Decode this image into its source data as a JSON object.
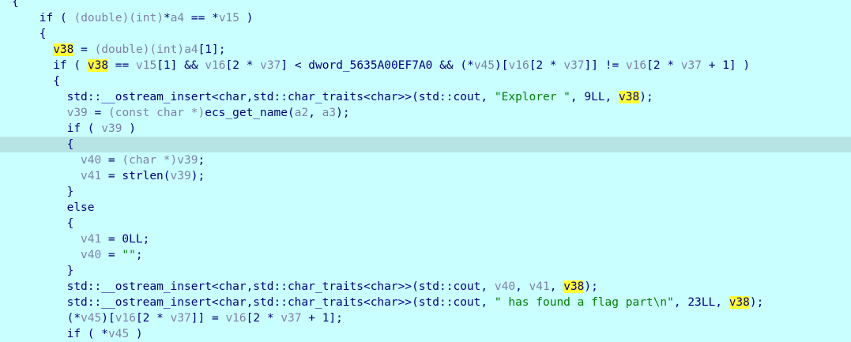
{
  "editor": {
    "current_line": 9,
    "colors": {
      "background": "#c9ffff",
      "current_line": "#b6e4e4",
      "highlight": "#ffff33",
      "code": "#000080",
      "variable": "#8080a8",
      "string": "#008000"
    },
    "lines": [
      {
        "indent": 0,
        "tokens": [
          [
            "id",
            "{"
          ]
        ]
      },
      {
        "indent": 2,
        "tokens": [
          [
            "kw",
            "if"
          ],
          [
            "op",
            " ( "
          ],
          [
            "var",
            "(double)(int)"
          ],
          [
            "op",
            "*"
          ],
          [
            "var",
            "a4"
          ],
          [
            "op",
            " == *"
          ],
          [
            "var",
            "v15"
          ],
          [
            "op",
            " )"
          ]
        ]
      },
      {
        "indent": 2,
        "tokens": [
          [
            "op",
            "{"
          ]
        ]
      },
      {
        "indent": 3,
        "tokens": [
          [
            "hl",
            "v38"
          ],
          [
            "op",
            " = "
          ],
          [
            "var",
            "(double)(int)"
          ],
          [
            "var",
            "a4"
          ],
          [
            "op",
            "[1];"
          ]
        ]
      },
      {
        "indent": 3,
        "tokens": [
          [
            "kw",
            "if"
          ],
          [
            "op",
            " ( "
          ],
          [
            "hl",
            "v38"
          ],
          [
            "op",
            " == "
          ],
          [
            "var",
            "v15"
          ],
          [
            "op",
            "[1] && "
          ],
          [
            "var",
            "v16"
          ],
          [
            "op",
            "[2 * "
          ],
          [
            "var",
            "v37"
          ],
          [
            "op",
            "] < "
          ],
          [
            "id",
            "dword_5635A00EF7A0"
          ],
          [
            "op",
            " && (*"
          ],
          [
            "var",
            "v45"
          ],
          [
            "op",
            ")["
          ],
          [
            "var",
            "v16"
          ],
          [
            "op",
            "[2 * "
          ],
          [
            "var",
            "v37"
          ],
          [
            "op",
            "]] != "
          ],
          [
            "var",
            "v16"
          ],
          [
            "op",
            "[2 * "
          ],
          [
            "var",
            "v37"
          ],
          [
            "op",
            " + 1] )"
          ]
        ]
      },
      {
        "indent": 3,
        "tokens": [
          [
            "op",
            "{"
          ]
        ]
      },
      {
        "indent": 4,
        "tokens": [
          [
            "id",
            "std::__ostream_insert<char,std::char_traits<char>>"
          ],
          [
            "op",
            "("
          ],
          [
            "id",
            "std::cout"
          ],
          [
            "op",
            ", "
          ],
          [
            "str",
            "\"Explorer \""
          ],
          [
            "op",
            ", 9LL, "
          ],
          [
            "hl",
            "v38"
          ],
          [
            "op",
            ");"
          ]
        ]
      },
      {
        "indent": 4,
        "tokens": [
          [
            "var",
            "v39"
          ],
          [
            "op",
            " = "
          ],
          [
            "var",
            "(const char *)"
          ],
          [
            "id",
            "ecs_get_name"
          ],
          [
            "op",
            "("
          ],
          [
            "var",
            "a2"
          ],
          [
            "op",
            ", "
          ],
          [
            "var",
            "a3"
          ],
          [
            "op",
            ");"
          ]
        ]
      },
      {
        "indent": 4,
        "tokens": [
          [
            "kw",
            "if"
          ],
          [
            "op",
            " ( "
          ],
          [
            "var",
            "v39"
          ],
          [
            "op",
            " )"
          ]
        ]
      },
      {
        "indent": 4,
        "tokens": [
          [
            "op",
            "{"
          ]
        ]
      },
      {
        "indent": 5,
        "tokens": [
          [
            "var",
            "v40"
          ],
          [
            "op",
            " = "
          ],
          [
            "var",
            "(char *)"
          ],
          [
            "var",
            "v39"
          ],
          [
            "op",
            ";"
          ]
        ]
      },
      {
        "indent": 5,
        "tokens": [
          [
            "var",
            "v41"
          ],
          [
            "op",
            " = "
          ],
          [
            "id",
            "strlen"
          ],
          [
            "op",
            "("
          ],
          [
            "var",
            "v39"
          ],
          [
            "op",
            ");"
          ]
        ]
      },
      {
        "indent": 4,
        "tokens": [
          [
            "op",
            "}"
          ]
        ]
      },
      {
        "indent": 4,
        "tokens": [
          [
            "kw",
            "else"
          ]
        ]
      },
      {
        "indent": 4,
        "tokens": [
          [
            "op",
            "{"
          ]
        ]
      },
      {
        "indent": 5,
        "tokens": [
          [
            "var",
            "v41"
          ],
          [
            "op",
            " = 0LL;"
          ]
        ]
      },
      {
        "indent": 5,
        "tokens": [
          [
            "var",
            "v40"
          ],
          [
            "op",
            " = "
          ],
          [
            "str",
            "\"\""
          ],
          [
            "op",
            ";"
          ]
        ]
      },
      {
        "indent": 4,
        "tokens": [
          [
            "op",
            "}"
          ]
        ]
      },
      {
        "indent": 4,
        "tokens": [
          [
            "id",
            "std::__ostream_insert<char,std::char_traits<char>>"
          ],
          [
            "op",
            "("
          ],
          [
            "id",
            "std::cout"
          ],
          [
            "op",
            ", "
          ],
          [
            "var",
            "v40"
          ],
          [
            "op",
            ", "
          ],
          [
            "var",
            "v41"
          ],
          [
            "op",
            ", "
          ],
          [
            "hl",
            "v38"
          ],
          [
            "op",
            ");"
          ]
        ]
      },
      {
        "indent": 4,
        "tokens": [
          [
            "id",
            "std::__ostream_insert<char,std::char_traits<char>>"
          ],
          [
            "op",
            "("
          ],
          [
            "id",
            "std::cout"
          ],
          [
            "op",
            ", "
          ],
          [
            "str",
            "\" has found a flag part\\n\""
          ],
          [
            "op",
            ", 23LL, "
          ],
          [
            "hl",
            "v38"
          ],
          [
            "op",
            ");"
          ]
        ]
      },
      {
        "indent": 4,
        "tokens": [
          [
            "op",
            "(*"
          ],
          [
            "var",
            "v45"
          ],
          [
            "op",
            ")["
          ],
          [
            "var",
            "v16"
          ],
          [
            "op",
            "[2 * "
          ],
          [
            "var",
            "v37"
          ],
          [
            "op",
            "]] = "
          ],
          [
            "var",
            "v16"
          ],
          [
            "op",
            "[2 * "
          ],
          [
            "var",
            "v37"
          ],
          [
            "op",
            " + 1];"
          ]
        ]
      },
      {
        "indent": 4,
        "tokens": [
          [
            "kw",
            "if"
          ],
          [
            "op",
            " ( *"
          ],
          [
            "var",
            "v45"
          ],
          [
            "op",
            " )"
          ]
        ]
      }
    ]
  }
}
